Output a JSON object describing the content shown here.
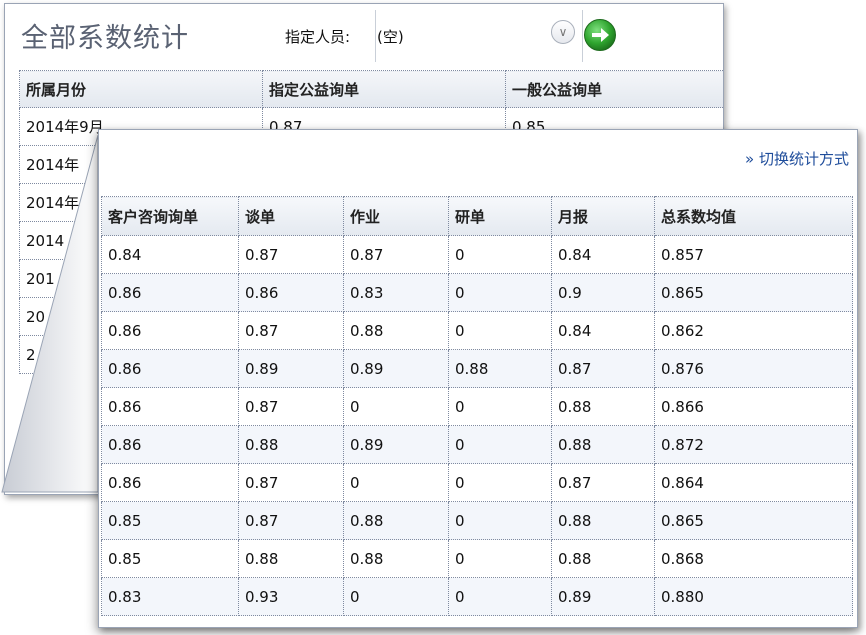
{
  "back": {
    "title": "全部系数统计",
    "assign_label": "指定人员:",
    "assign_value": "(空)",
    "headers": [
      "所属月份",
      "指定公益询单",
      "一般公益询单"
    ],
    "rows": [
      [
        "2014年9月",
        "0.87",
        "0.85"
      ],
      [
        "2014年",
        "",
        ""
      ],
      [
        "2014年",
        "",
        ""
      ],
      [
        "2014",
        "",
        ""
      ],
      [
        "201",
        "",
        ""
      ],
      [
        "20",
        "",
        ""
      ],
      [
        "2",
        "",
        ""
      ]
    ]
  },
  "front": {
    "switch_label": "» 切换统计方式",
    "headers": [
      "客户咨询询单",
      "谈单",
      "作业",
      "研单",
      "月报",
      "总系数均值"
    ],
    "rows": [
      [
        "0.84",
        "0.87",
        "0.87",
        "0",
        "0.84",
        "0.857"
      ],
      [
        "0.86",
        "0.86",
        "0.83",
        "0",
        "0.9",
        "0.865"
      ],
      [
        "0.86",
        "0.87",
        "0.88",
        "0",
        "0.84",
        "0.862"
      ],
      [
        "0.86",
        "0.89",
        "0.89",
        "0.88",
        "0.87",
        "0.876"
      ],
      [
        "0.86",
        "0.87",
        "0",
        "0",
        "0.88",
        "0.866"
      ],
      [
        "0.86",
        "0.88",
        "0.89",
        "0",
        "0.88",
        "0.872"
      ],
      [
        "0.86",
        "0.87",
        "0",
        "0",
        "0.87",
        "0.864"
      ],
      [
        "0.85",
        "0.87",
        "0.88",
        "0",
        "0.88",
        "0.865"
      ],
      [
        "0.85",
        "0.88",
        "0.88",
        "0",
        "0.88",
        "0.868"
      ],
      [
        "0.83",
        "0.93",
        "0",
        "0",
        "0.89",
        "0.880"
      ]
    ]
  },
  "icons": {
    "dropdown": "chevron-double-down-icon",
    "go": "arrow-right-circle-icon"
  },
  "colors": {
    "go_green": "#2fa52f",
    "link_blue": "#1f4d9b",
    "header_bg": "#e4e9f0",
    "grid": "#7f8aa0"
  }
}
